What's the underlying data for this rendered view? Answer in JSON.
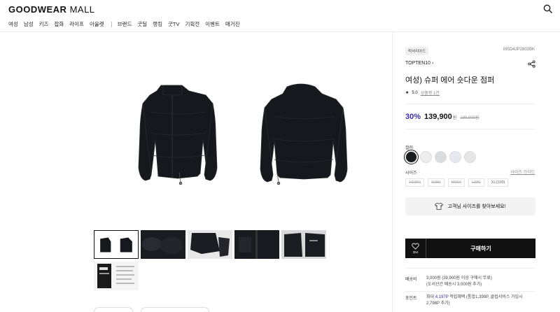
{
  "header": {
    "logo_bold": "GOODWEAR",
    "logo_thin": "MALL",
    "nav_main": [
      "여성",
      "남성",
      "키즈",
      "잡화",
      "라이프",
      "아울렛"
    ],
    "nav_sub": [
      "브랜드",
      "굿딜",
      "랭킹",
      "굿TV",
      "기획전",
      "이벤트",
      "매거진"
    ]
  },
  "product": {
    "tag": "럭셔리아드",
    "code": "MSD4JP2802BK",
    "brand": "TOPTEN10 ›",
    "title": "여성) 슈퍼 에어 숏다운 점퍼",
    "rating_star": "★",
    "rating": "5.0",
    "review_link": "상품평 1건",
    "discount": "30%",
    "price": "139,900",
    "price_unit": "원",
    "original_price": "199,900원",
    "color_label": "컬러",
    "colors": [
      "#1c1d22",
      "#eeeeee",
      "#d9dde0",
      "#e8e8f2",
      "#e6e6e6"
    ],
    "size_label": "사이즈",
    "size_guide": "사이즈 가이드",
    "sizes": [
      "XS(80)",
      "S(85)",
      "M(90)",
      "L(95)",
      "XL(100)"
    ],
    "find_size": "고객님 사이즈를 찾아보세요!",
    "wish_count": "354",
    "buy_label": "구매하기"
  },
  "info": {
    "shipping_label": "배송비",
    "shipping_line1": "3,000원 (39,900원 이상 구매시 무료)",
    "shipping_line2": "(도서산간 배송시 3,000원 추가)",
    "point_label": "포인트",
    "point_prefix": "최대",
    "point_value": "4,197P",
    "point_line1_rest": "적립혜택 (통합1,399P, 클럽서비스 가입시",
    "point_line2": "2,798P 추가)"
  },
  "colors": {
    "accent": "#3a2cb0",
    "button": "#111111"
  }
}
